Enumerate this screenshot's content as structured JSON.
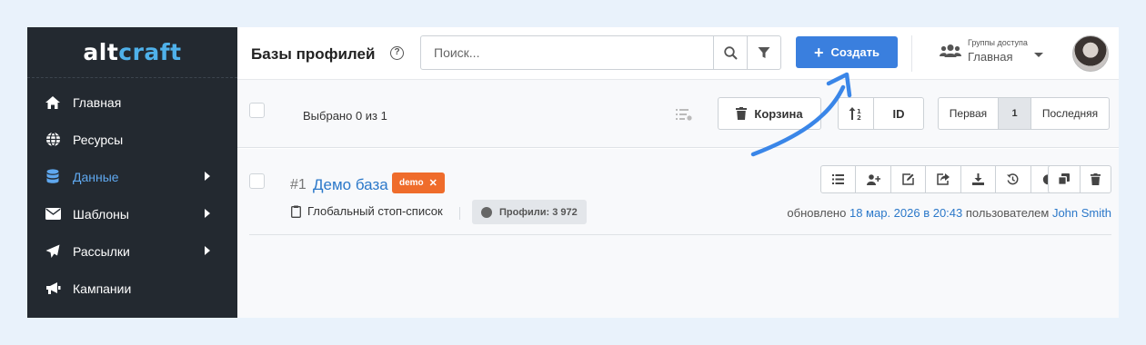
{
  "sidebar": {
    "logo": {
      "part1": "alt",
      "part2": "craft"
    },
    "items": [
      {
        "label": "Главная",
        "icon": "home-icon"
      },
      {
        "label": "Ресурсы",
        "icon": "globe-icon"
      },
      {
        "label": "Данные",
        "icon": "database-icon",
        "active": true,
        "has_submenu": true
      },
      {
        "label": "Шаблоны",
        "icon": "envelope-icon",
        "has_submenu": true
      },
      {
        "label": "Рассылки",
        "icon": "paper-plane-icon",
        "has_submenu": true
      },
      {
        "label": "Кампании",
        "icon": "megaphone-icon"
      }
    ]
  },
  "header": {
    "title": "Базы профилей",
    "search_placeholder": "Поиск...",
    "create_label": "Создать",
    "access_caption": "Группы доступа",
    "access_value": "Главная"
  },
  "toolbar": {
    "selected_text": "Выбрано 0 из 1",
    "trash_label": "Корзина",
    "sort_field": "ID",
    "pager": {
      "first": "Первая",
      "current": "1",
      "last": "Последняя"
    }
  },
  "rows": [
    {
      "number": "#1",
      "name": "Демо база",
      "tag": "demo",
      "stoplist": "Глобальный стоп-список",
      "profiles": "Профили: 3 972",
      "updated_prefix": "обновлено",
      "updated_date": "18 мар. 2026 в 20:43",
      "updated_by_prefix": "пользователем",
      "updated_by": "John Smith"
    }
  ],
  "colors": {
    "sidebar_bg": "#232930",
    "accent": "#3a7fde",
    "tag": "#ef6c2b",
    "link": "#2b78c9"
  }
}
